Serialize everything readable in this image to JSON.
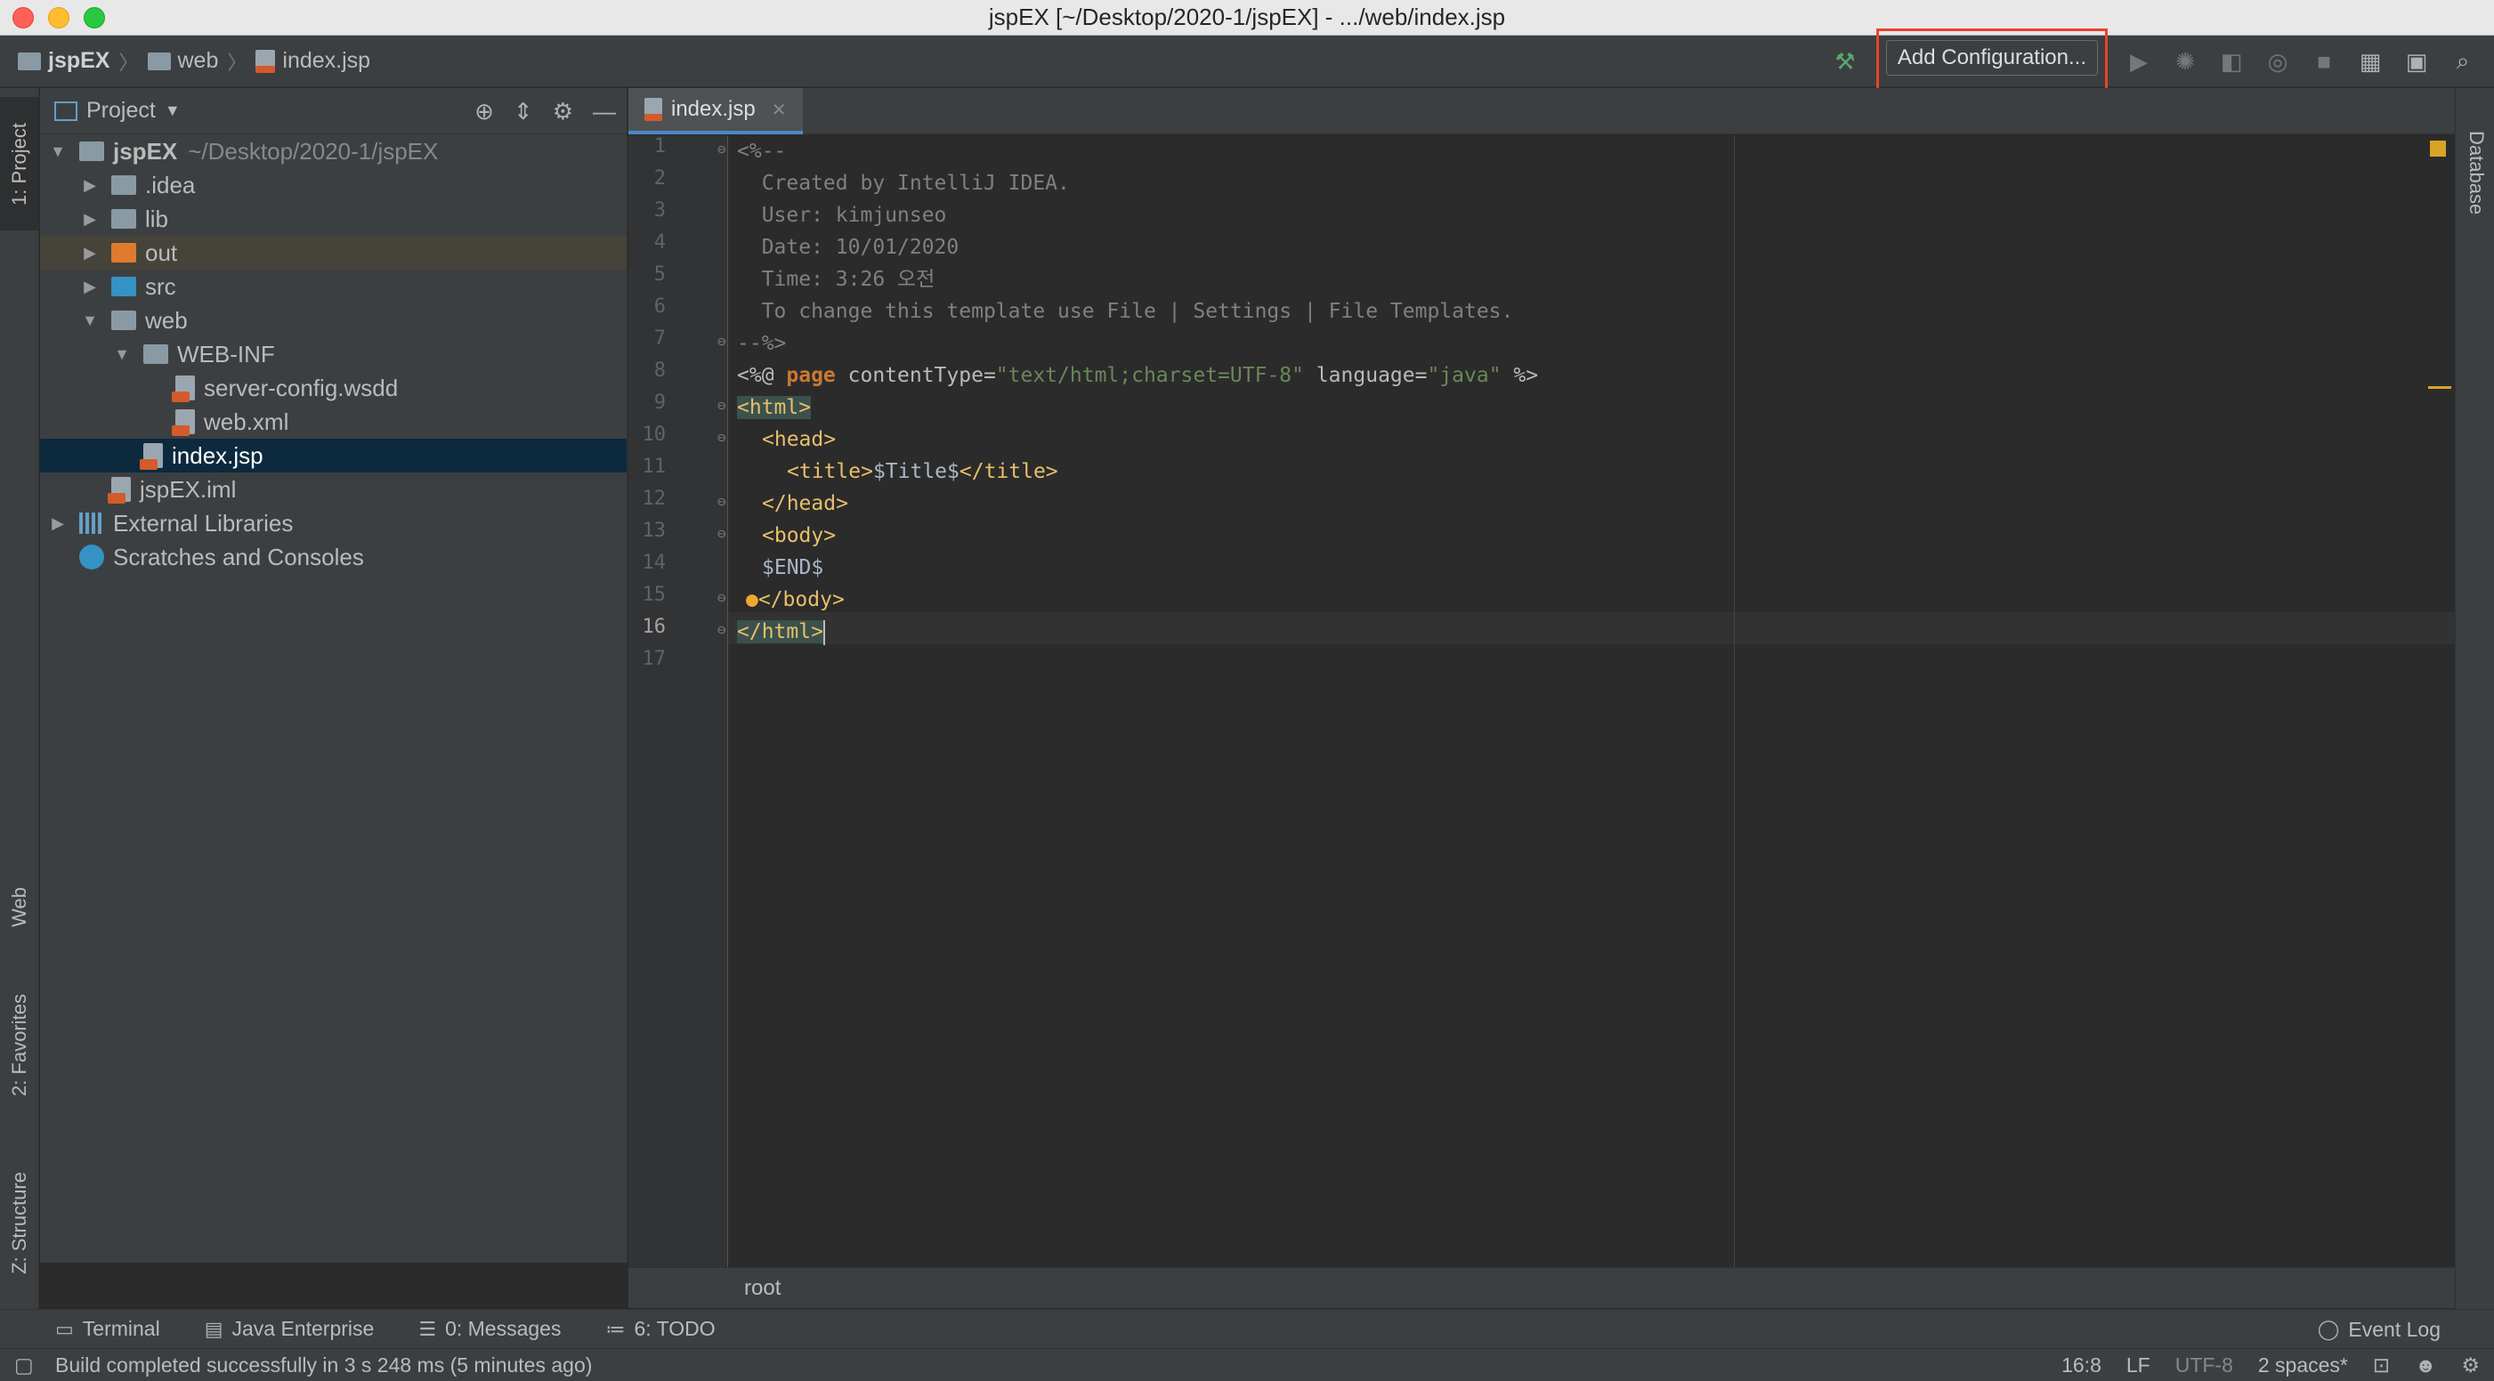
{
  "window": {
    "title": "jspEX [~/Desktop/2020-1/jspEX] - .../web/index.jsp"
  },
  "nav": {
    "crumbs": [
      "jspEX",
      "web",
      "index.jsp"
    ],
    "add_config": "Add Configuration..."
  },
  "left_stripe": {
    "tabs": [
      "1: Project",
      "Web",
      "2: Favorites",
      "Z: Structure"
    ]
  },
  "right_stripe": {
    "tabs": [
      "Database"
    ]
  },
  "project": {
    "title": "Project",
    "root_name": "jspEX",
    "root_path": "~/Desktop/2020-1/jspEX",
    "items": [
      {
        "label": ".idea"
      },
      {
        "label": "lib"
      },
      {
        "label": "out"
      },
      {
        "label": "src"
      },
      {
        "label": "web"
      },
      {
        "label": "WEB-INF"
      },
      {
        "label": "server-config.wsdd"
      },
      {
        "label": "web.xml"
      },
      {
        "label": "index.jsp"
      },
      {
        "label": "jspEX.iml"
      },
      {
        "label": "External Libraries"
      },
      {
        "label": "Scratches and Consoles"
      }
    ]
  },
  "editor": {
    "tab": "index.jsp",
    "line_numbers": [
      "1",
      "2",
      "3",
      "4",
      "5",
      "6",
      "7",
      "8",
      "9",
      "10",
      "11",
      "12",
      "13",
      "14",
      "15",
      "16",
      "17"
    ],
    "lines": {
      "l1": "<%--",
      "l2": "  Created by IntelliJ IDEA.",
      "l3": "  User: kimjunseo",
      "l4": "  Date: 10/01/2020",
      "l5": "  Time: 3:26 오전",
      "l6": "  To change this template use File | Settings | File Templates.",
      "l7": "--%>",
      "l8_a": "<%@ ",
      "l8_b": "page",
      "l8_c": " contentType=",
      "l8_d": "\"text/html;charset=UTF-8\"",
      "l8_e": " language=",
      "l8_f": "\"java\"",
      "l8_g": " %>",
      "l9": "<html>",
      "l10": "<head>",
      "l11_a": "<title>",
      "l11_b": "$Title$",
      "l11_c": "</title>",
      "l12": "</head>",
      "l13": "<body>",
      "l14": "$END$",
      "l15": "</body>",
      "l16": "</html>"
    },
    "breadcrumb": "root"
  },
  "bottom_tools": {
    "terminal": "Terminal",
    "java_enterprise": "Java Enterprise",
    "messages": "0: Messages",
    "todo": "6: TODO",
    "event_log": "Event Log"
  },
  "status": {
    "message": "Build completed successfully in 3 s 248 ms (5 minutes ago)",
    "position": "16:8",
    "line_sep": "LF",
    "encoding": "UTF-8",
    "indent": "2 spaces*"
  }
}
